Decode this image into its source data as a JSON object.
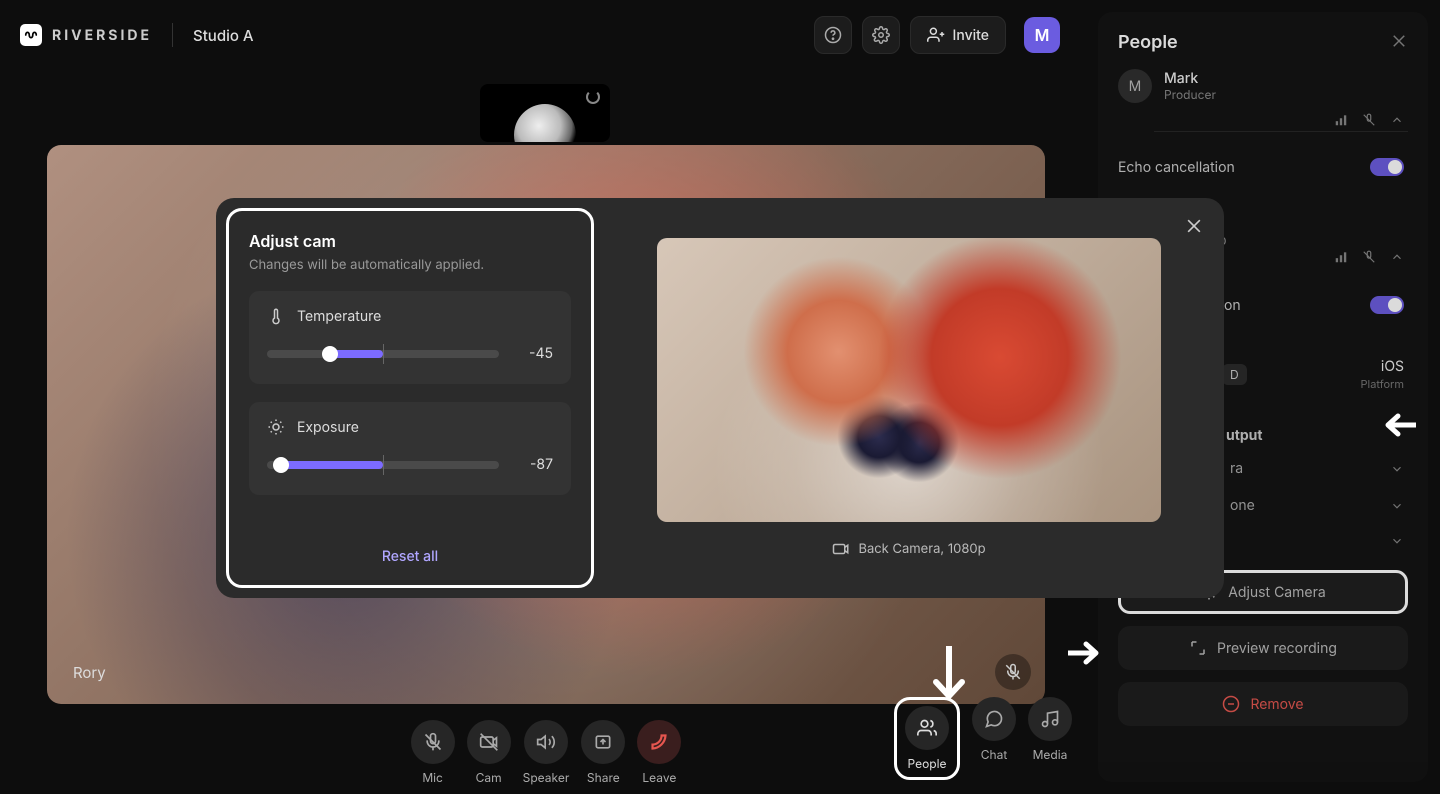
{
  "app": {
    "brand": "RIVERSIDE",
    "studio": "Studio A",
    "invite_label": "Invite",
    "user_initial": "M"
  },
  "stage": {
    "participant_name": "Rory"
  },
  "bottom_controls": {
    "mic": "Mic",
    "cam": "Cam",
    "speaker": "Speaker",
    "share": "Share",
    "leave": "Leave",
    "people": "People",
    "chat": "Chat",
    "media": "Media"
  },
  "right_panel": {
    "title": "People",
    "participant": {
      "initial": "M",
      "name": "Mark",
      "role": "Producer"
    },
    "echo_label": "Echo cancellation",
    "res_partial": "p",
    "other_toggle_partial": "on",
    "rec_badge_partial": "D",
    "platform": {
      "name": "iOS",
      "caption": "Platform"
    },
    "output_header_partial": "utput",
    "output_rows": {
      "row1_partial": "ra",
      "row2_partial": "one",
      "row3_partial": ""
    },
    "adjust_camera": "Adjust Camera",
    "preview_recording": "Preview recording",
    "remove": "Remove"
  },
  "modal": {
    "title": "Adjust cam",
    "subtitle": "Changes will be automatically applied.",
    "temperature": {
      "label": "Temperature",
      "value": -45,
      "fill_left_pct": 27,
      "fill_right_pct": 50
    },
    "exposure": {
      "label": "Exposure",
      "value": -87,
      "fill_left_pct": 6,
      "fill_right_pct": 50
    },
    "reset": "Reset all",
    "camera_label": "Back Camera, 1080p"
  }
}
